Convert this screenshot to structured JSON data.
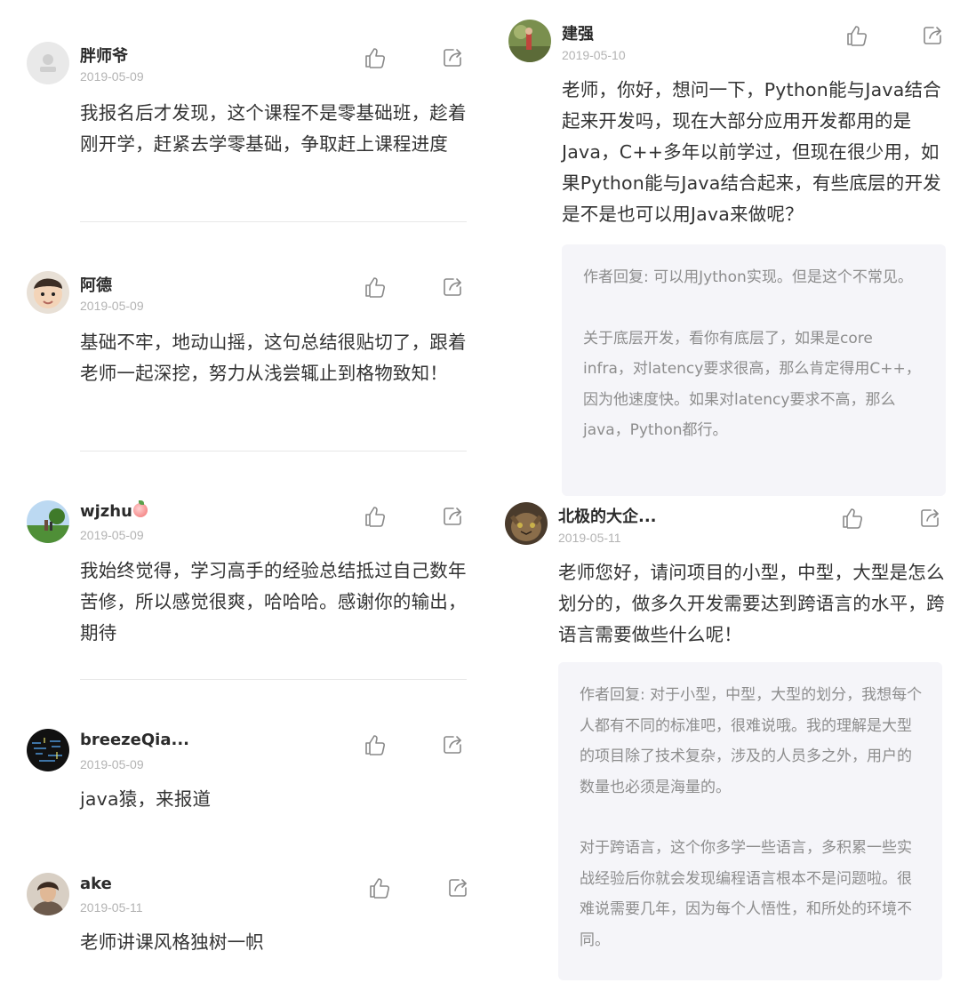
{
  "left_column": {
    "comments": [
      {
        "name": "胖师爷",
        "date": "2019-05-09",
        "text": "我报名后才发现，这个课程不是零基础班，趁着刚开学，赶紧去学零基础，争取赶上课程进度"
      },
      {
        "name": "阿德",
        "date": "2019-05-09",
        "text": "基础不牢，地动山摇，这句总结很贴切了，跟着老师一起深挖，努力从浅尝辄止到格物致知！"
      },
      {
        "name": "wjzhu",
        "date": "2019-05-09",
        "text": "我始终觉得，学习高手的经验总结抵过自己数年苦修，所以感觉很爽，哈哈哈。感谢你的输出，期待"
      },
      {
        "name": "breezeQia...",
        "date": "2019-05-09",
        "text": "java猿，来报道"
      },
      {
        "name": "ake",
        "date": "2019-05-11",
        "text": "老师讲课风格独树一帜"
      }
    ]
  },
  "right_column": {
    "comments": [
      {
        "name": "建强",
        "date": "2019-05-10",
        "text": "老师，你好，想问一下，Python能与Java结合起来开发吗，现在大部分应用开发都用的是Java，C++多年以前学过，但现在很少用，如果Python能与Java结合起来，有些底层的开发是不是也可以用Java来做呢？",
        "reply": {
          "p1": "作者回复: 可以用Jython实现。但是这个不常见。",
          "p2": "关于底层开发，看你有底层了，如果是core infra，对latency要求很高，那么肯定得用C++，因为他速度快。如果对latency要求不高，那么java，Python都行。"
        }
      },
      {
        "name": "北极的大企...",
        "date": "2019-05-11",
        "text": "老师您好，请问项目的小型，中型，大型是怎么划分的，做多久开发需要达到跨语言的水平，跨语言需要做些什么呢！",
        "reply": {
          "p1": "作者回复: 对于小型，中型，大型的划分，我想每个人都有不同的标准吧，很难说哦。我的理解是大型的项目除了技术复杂，涉及的人员多之外，用户的数量也必须是海量的。",
          "p2": "对于跨语言，这个你多学一些语言，多积累一些实战经验后你就会发现编程语言根本不是问题啦。很难说需要几年，因为每个人悟性，和所处的环境不同。"
        }
      }
    ]
  },
  "icons": {
    "like": "thumbs-up-icon",
    "share": "share-icon",
    "emoji": "peach-icon"
  },
  "colors": {
    "name": "#2b2b2b",
    "date": "#b3b3b3",
    "body": "#333333",
    "reply_bg": "#f5f5f9",
    "reply_text": "#8d8d8d",
    "icon": "#888888"
  }
}
